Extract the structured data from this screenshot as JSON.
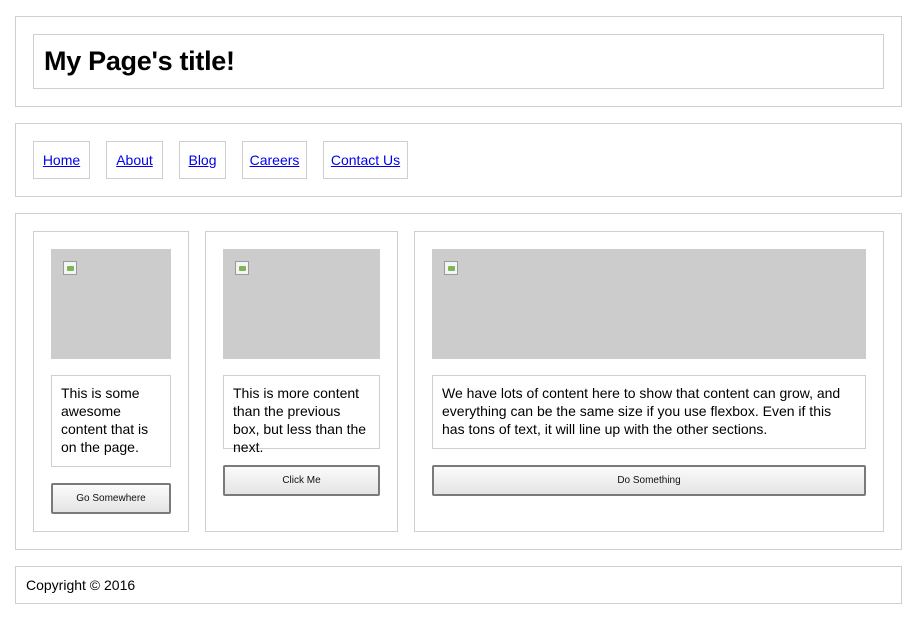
{
  "header": {
    "title": "My Page's title!"
  },
  "nav": {
    "items": [
      "Home",
      "About",
      "Blog",
      "Careers",
      "Contact Us"
    ]
  },
  "cards": [
    {
      "text": "This is some awesome content that is on the page.",
      "button": "Go Somewhere"
    },
    {
      "text": "This is more content than the previous box, but less than the next.",
      "button": "Click Me"
    },
    {
      "text": "We have lots of content here to show that content can grow, and everything can be the same size if you use flexbox. Even if this has tons of text, it will line up with the other sections.",
      "button": "Do Something"
    }
  ],
  "footer": {
    "copyright": "Copyright © 2016"
  },
  "colors": {
    "link": "#0000ee",
    "image_placeholder": "#cccccc",
    "border": "#cfcfcf"
  }
}
